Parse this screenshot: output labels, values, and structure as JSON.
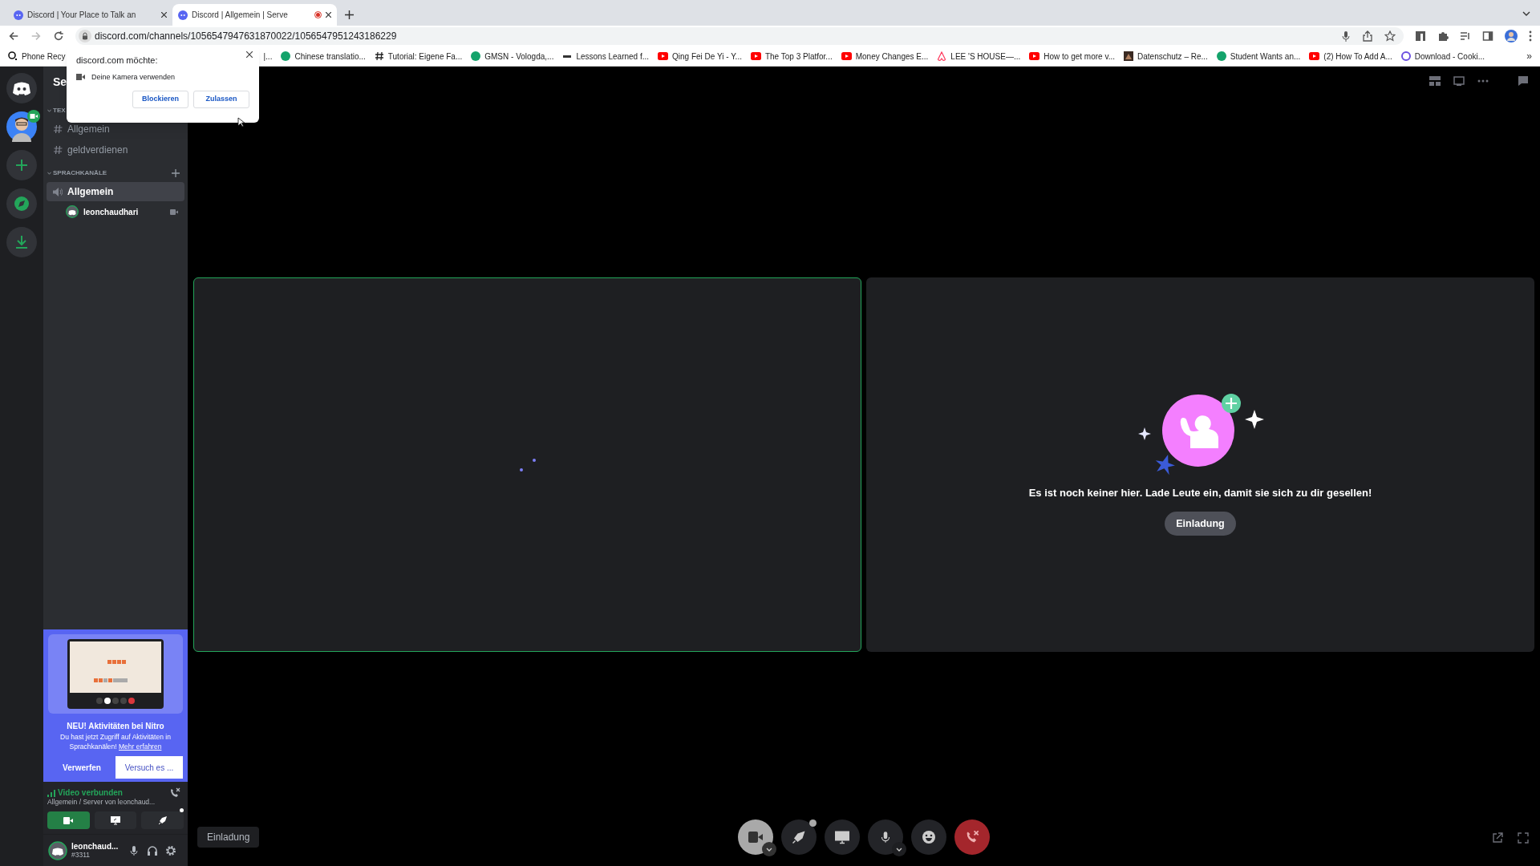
{
  "browser": {
    "tabs": [
      {
        "title": "Discord | Your Place to Talk an",
        "selected": false,
        "recording": false
      },
      {
        "title": "Discord | Allgemein | Serve",
        "selected": true,
        "recording": true
      }
    ],
    "url": "discord.com/channels/1056547947631870022/1056547951243186229",
    "bookmarks": [
      {
        "title": "Phone Recy",
        "kind": "o2"
      },
      {
        "title": "|...",
        "kind": "none"
      },
      {
        "title": "Chinese translatio...",
        "kind": "green"
      },
      {
        "title": "Tutorial: Eigene Fa...",
        "kind": "hash"
      },
      {
        "title": "GMSN - Vologda,...",
        "kind": "green"
      },
      {
        "title": "Lessons Learned f...",
        "kind": "text"
      },
      {
        "title": "Qing Fei De Yi - Y...",
        "kind": "youtube"
      },
      {
        "title": "The Top 3 Platfor...",
        "kind": "youtube"
      },
      {
        "title": "Money Changes E...",
        "kind": "youtube"
      },
      {
        "title": "LEE 'S HOUSE—...",
        "kind": "airbnb"
      },
      {
        "title": "How to get more v...",
        "kind": "youtube"
      },
      {
        "title": "Datenschutz – Re..."
      },
      {
        "title": "Student Wants an...",
        "kind": "green"
      },
      {
        "title": "(2) How To Add A...",
        "kind": "youtube"
      },
      {
        "title": "Download - Cooki...",
        "kind": "purple"
      }
    ],
    "more": "»"
  },
  "permission_popup": {
    "title": "discord.com möchte:",
    "request": "Deine Kamera verwenden",
    "buttons": [
      "Blockieren",
      "Zulassen"
    ]
  },
  "channel_sidebar": {
    "server_name": "Se",
    "categories": [
      {
        "name": "TEX",
        "kind": "text",
        "channels": [
          {
            "name": "Allgemein",
            "selected": false
          },
          {
            "name": "geldverdienen",
            "selected": false
          }
        ]
      },
      {
        "name": "SPRACHKANÄLE",
        "kind": "voice",
        "channels": [
          {
            "name": "Allgemein",
            "selected": true,
            "members": [
              {
                "name": "leonchaudhari"
              }
            ]
          }
        ]
      }
    ]
  },
  "nitro_card": {
    "title": "NEU! Aktivitäten bei Nitro",
    "body": "Du hast jetzt Zugriff auf Aktivitäten in Sprachkanälen!",
    "link": "Mehr erfahren",
    "buttons": [
      "Verwerfen",
      "Versuch es ..."
    ]
  },
  "voice_panel": {
    "status": "Video verbunden",
    "location": "Allgemein / Server von leonchaud...",
    "camera_on": true
  },
  "user_panel": {
    "name": "leonchaud...",
    "tag": "#3311"
  },
  "stage": {
    "tiles": [
      {
        "kind": "video",
        "speaking": true
      },
      {
        "kind": "empty",
        "speaking": false,
        "message": "Es ist noch keiner hier. Lade Leute ein, damit sie sich zu dir gesellen!",
        "button": "Einladung"
      }
    ],
    "invite_button": "Einladung"
  }
}
